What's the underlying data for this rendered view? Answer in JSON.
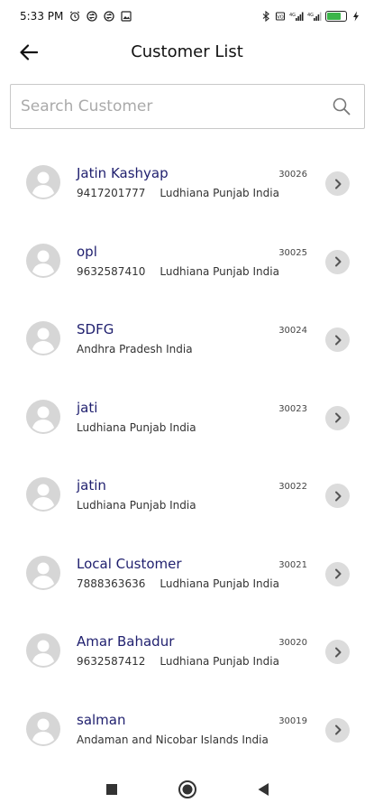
{
  "status_bar": {
    "time": "5:33 PM",
    "battery_level": 0.75,
    "battery_color": "#3bb54a",
    "icons": [
      "alarm-icon",
      "sync-icon",
      "sync-icon",
      "image-icon",
      "bluetooth-icon",
      "vibrate-icon",
      "signal-icon",
      "signal-icon",
      "battery-icon",
      "charging-icon"
    ]
  },
  "header": {
    "title": "Customer List"
  },
  "search": {
    "placeholder": "Search Customer",
    "value": ""
  },
  "colors": {
    "name_text": "#1f1f6e",
    "avatar_bg": "#d6d6d6",
    "chevron_bg": "#dcdcdc"
  },
  "customers": [
    {
      "name": "Jatin Kashyap",
      "code": "30026",
      "phone": "9417201777",
      "location": "Ludhiana Punjab India"
    },
    {
      "name": "opl",
      "code": "30025",
      "phone": "9632587410",
      "location": "Ludhiana Punjab India"
    },
    {
      "name": "SDFG",
      "code": "30024",
      "phone": "",
      "location": "Andhra Pradesh India"
    },
    {
      "name": "jati",
      "code": "30023",
      "phone": "",
      "location": "Ludhiana Punjab India"
    },
    {
      "name": "jatin",
      "code": "30022",
      "phone": "",
      "location": "Ludhiana Punjab India"
    },
    {
      "name": "Local Customer",
      "code": "30021",
      "phone": "7888363636",
      "location": "Ludhiana Punjab India"
    },
    {
      "name": "Amar Bahadur",
      "code": "30020",
      "phone": "9632587412",
      "location": "Ludhiana Punjab India"
    },
    {
      "name": "salman",
      "code": "30019",
      "phone": "",
      "location": "Andaman and Nicobar Islands India"
    }
  ]
}
